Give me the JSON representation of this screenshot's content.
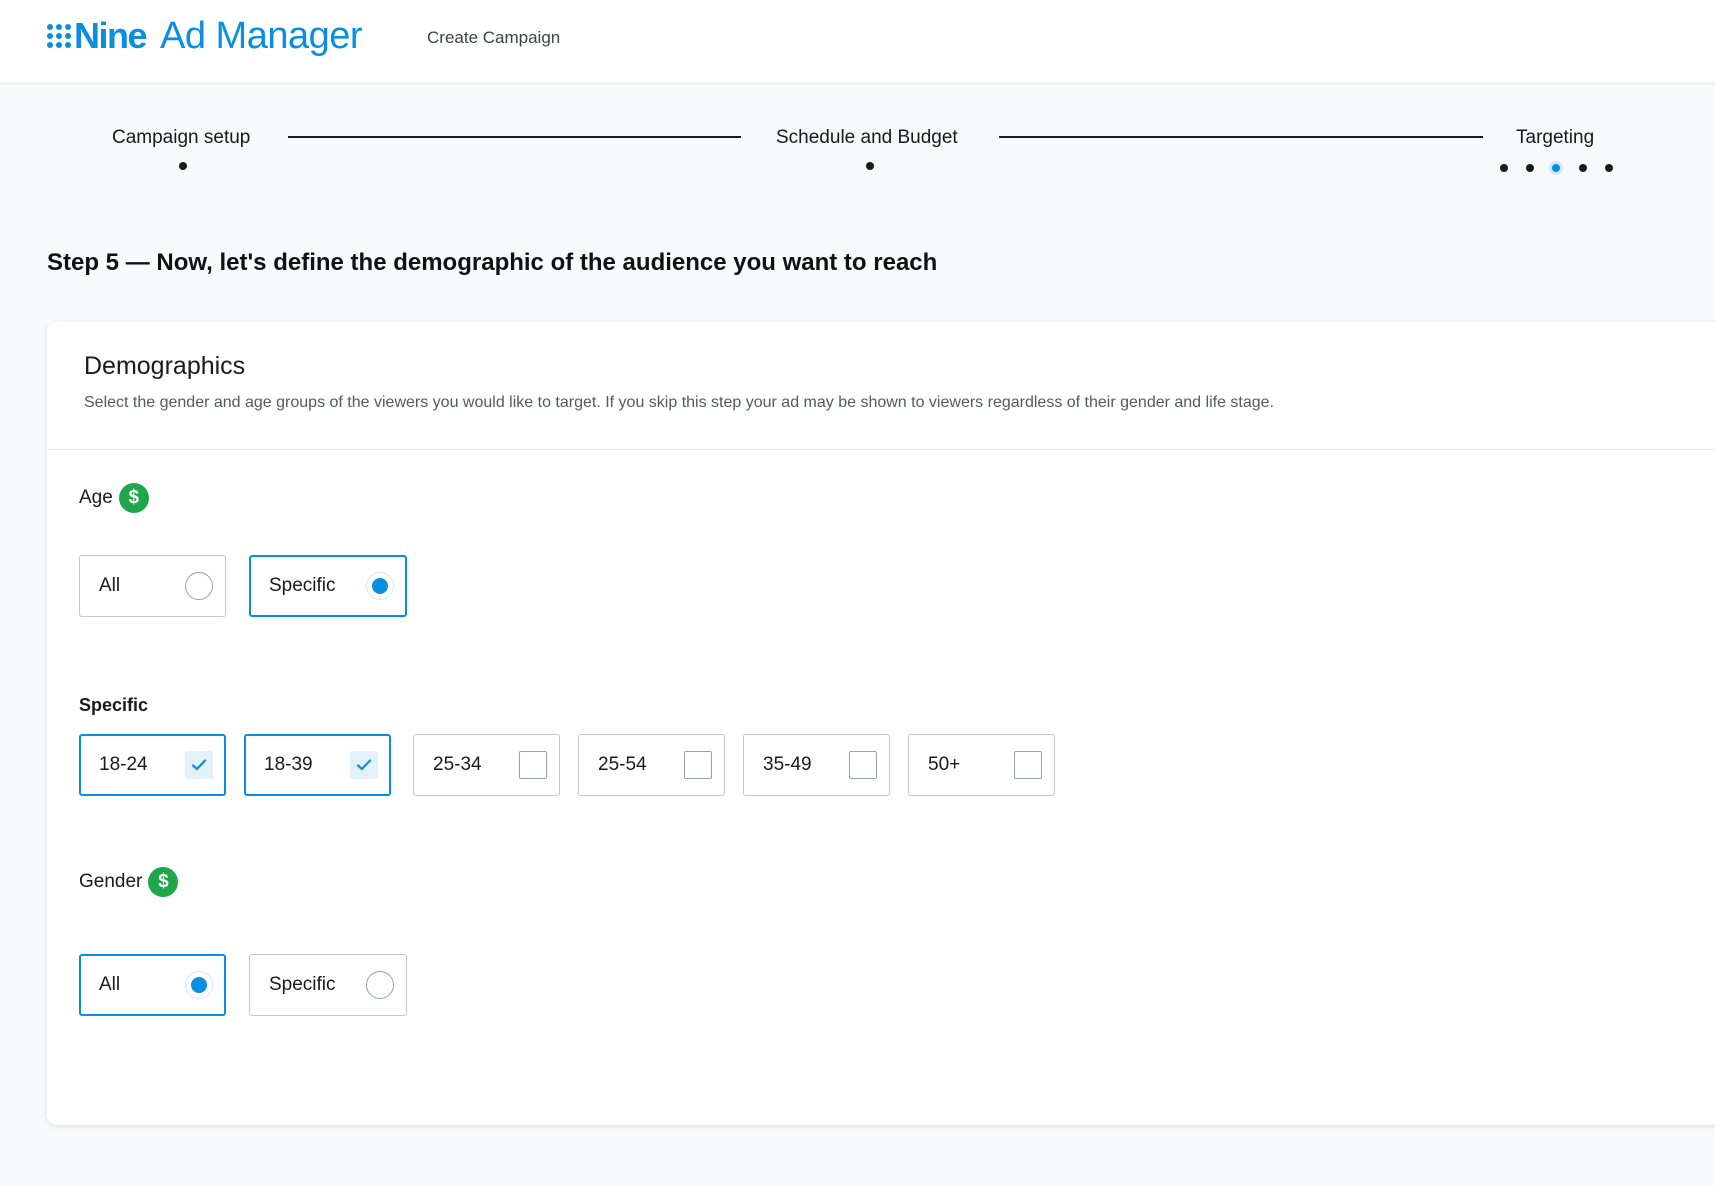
{
  "header": {
    "brand_name": "Nine",
    "brand_product": "Ad Manager",
    "page_title": "Create Campaign"
  },
  "stepper": {
    "steps": [
      {
        "label": "Campaign setup"
      },
      {
        "label": "Schedule and Budget"
      },
      {
        "label": "Targeting"
      }
    ],
    "targeting_substeps_total": 5,
    "targeting_substep_current": 3
  },
  "step_heading": "Step 5 — Now, let's define the demographic of the audience you want to reach",
  "demographics": {
    "title": "Demographics",
    "description": "Select the gender and age groups of the viewers you would like to target. If you skip this step your ad may be shown to viewers regardless of their gender and life stage.",
    "age": {
      "label": "Age",
      "paid_icon": "$",
      "options": [
        {
          "label": "All",
          "selected": false
        },
        {
          "label": "Specific",
          "selected": true
        }
      ]
    },
    "specific": {
      "label": "Specific",
      "ranges": [
        {
          "label": "18-24",
          "checked": true
        },
        {
          "label": "18-39",
          "checked": true
        },
        {
          "label": "25-34",
          "checked": false
        },
        {
          "label": "25-54",
          "checked": false
        },
        {
          "label": "35-49",
          "checked": false
        },
        {
          "label": "50+",
          "checked": false
        }
      ]
    },
    "gender": {
      "label": "Gender",
      "paid_icon": "$",
      "options": [
        {
          "label": "All",
          "selected": true
        },
        {
          "label": "Specific",
          "selected": false
        }
      ]
    }
  },
  "colors": {
    "accent": "#0a8ee0",
    "paid_badge": "#1fa64a"
  }
}
